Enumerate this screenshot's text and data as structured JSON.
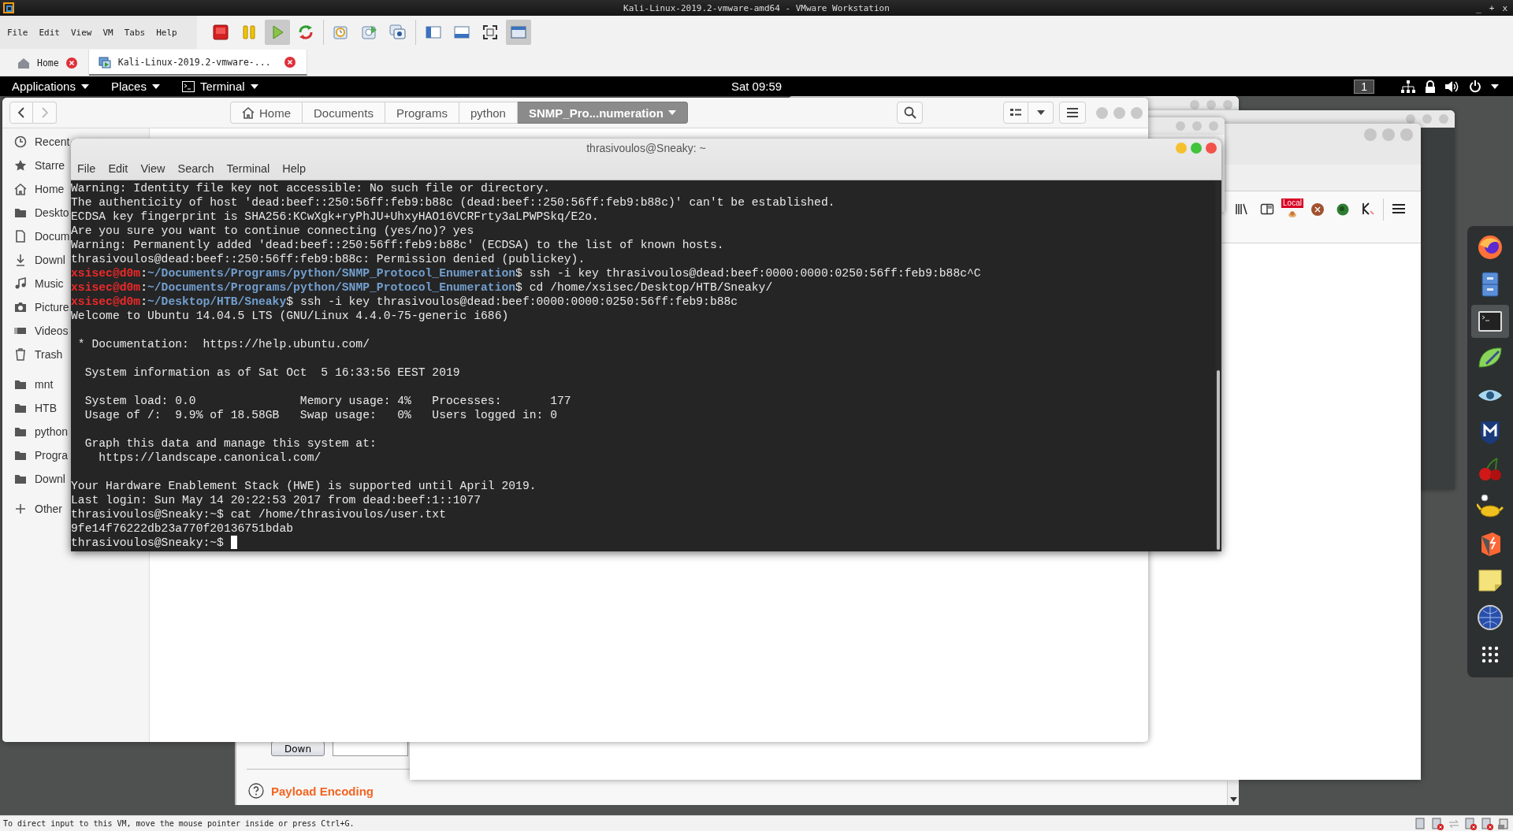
{
  "vmware": {
    "title": "Kali-Linux-2019.2-vmware-amd64 - VMware Workstation",
    "window_controls": [
      "_",
      "+",
      "x"
    ],
    "menu": [
      "File",
      "Edit",
      "View",
      "VM",
      "Tabs",
      "Help"
    ],
    "toolbar_groups": [
      {
        "buttons": [
          {
            "kind": "stop",
            "pressed": false
          },
          {
            "kind": "pause",
            "pressed": false
          },
          {
            "kind": "play",
            "pressed": true
          },
          {
            "kind": "revert",
            "pressed": false
          }
        ]
      },
      {
        "buttons": [
          {
            "kind": "snapshot",
            "pressed": false
          },
          {
            "kind": "snapshot-revert",
            "pressed": false
          },
          {
            "kind": "snapshot-manager",
            "pressed": false
          }
        ]
      },
      {
        "buttons": [
          {
            "kind": "library",
            "pressed": false
          },
          {
            "kind": "console",
            "pressed": false
          },
          {
            "kind": "fullscreen",
            "pressed": false
          },
          {
            "kind": "unity",
            "pressed": true
          }
        ]
      }
    ],
    "tabs": [
      {
        "label": "Home",
        "kind": "home",
        "selected": false
      },
      {
        "label": "Kali-Linux-2019.2-vmware-...",
        "kind": "vm",
        "selected": true
      }
    ],
    "status_text": "To direct input to this VM, move the mouse pointer inside or press Ctrl+G."
  },
  "panel": {
    "menus": [
      {
        "label": "Applications",
        "kind": "menu"
      },
      {
        "label": "Places",
        "kind": "menu"
      },
      {
        "label": "Terminal",
        "kind": "app"
      }
    ],
    "clock": "Sat 09:59",
    "workspace": "1"
  },
  "files": {
    "path": [
      {
        "label": "Home",
        "kind": "home",
        "selected": false
      },
      {
        "label": "Documents",
        "kind": "folder",
        "selected": false
      },
      {
        "label": "Programs",
        "kind": "folder",
        "selected": false
      },
      {
        "label": "python",
        "kind": "folder",
        "selected": false
      },
      {
        "label": "SNMP_Pro...numeration",
        "kind": "folder",
        "selected": true
      }
    ],
    "sidebar_sections": [
      {
        "items": [
          {
            "label": "Recent",
            "kind": "recent"
          },
          {
            "label": "Starre",
            "kind": "starred"
          },
          {
            "label": "Home",
            "kind": "home"
          },
          {
            "label": "Deskto",
            "kind": "folder"
          },
          {
            "label": "Docum",
            "kind": "document"
          },
          {
            "label": "Downl",
            "kind": "download"
          },
          {
            "label": "Music",
            "kind": "music"
          },
          {
            "label": "Picture",
            "kind": "camera"
          },
          {
            "label": "Videos",
            "kind": "video"
          },
          {
            "label": "Trash",
            "kind": "trash"
          }
        ]
      },
      {
        "items": [
          {
            "label": "mnt",
            "kind": "folder"
          },
          {
            "label": "HTB",
            "kind": "folder"
          },
          {
            "label": "python",
            "kind": "folder"
          },
          {
            "label": "Progra",
            "kind": "folder"
          },
          {
            "label": "Downl",
            "kind": "folder"
          }
        ]
      },
      {
        "items": [
          {
            "label": "Other",
            "kind": "other"
          }
        ]
      }
    ]
  },
  "browser": {
    "badge": "Local"
  },
  "burp": {
    "button": "Down",
    "section": "Payload Encoding"
  },
  "terminal": {
    "title": "thrasivoulos@Sneaky: ~",
    "menu": [
      "File",
      "Edit",
      "View",
      "Search",
      "Terminal",
      "Help"
    ],
    "lines": [
      {
        "kind": "output",
        "text": "Warning: Identity file key not accessible: No such file or directory."
      },
      {
        "kind": "output",
        "text": "The authenticity of host 'dead:beef::250:56ff:feb9:b88c (dead:beef::250:56ff:feb9:b88c)' can't be established."
      },
      {
        "kind": "output",
        "text": "ECDSA key fingerprint is SHA256:KCwXgk+ryPhJU+UhxyHAO16VCRFrty3aLPWPSkq/E2o."
      },
      {
        "kind": "output",
        "text": "Are you sure you want to continue connecting (yes/no)? yes"
      },
      {
        "kind": "output",
        "text": "Warning: Permanently added 'dead:beef::250:56ff:feb9:b88c' (ECDSA) to the list of known hosts."
      },
      {
        "kind": "output",
        "text": "thrasivoulos@dead:beef::250:56ff:feb9:b88c: Permission denied (publickey)."
      },
      {
        "kind": "prompt",
        "user": "xsisec@d0m",
        "sep": ":",
        "path": "~/Documents/Programs/python/SNMP_Protocol_Enumeration",
        "end": "$",
        "command": "ssh -i key thrasivoulos@dead:beef:0000:0000:0250:56ff:feb9:b88c^C"
      },
      {
        "kind": "prompt",
        "user": "xsisec@d0m",
        "sep": ":",
        "path": "~/Documents/Programs/python/SNMP_Protocol_Enumeration",
        "end": "$",
        "command": "cd /home/xsisec/Desktop/HTB/Sneaky/"
      },
      {
        "kind": "prompt",
        "user": "xsisec@d0m",
        "sep": ":",
        "path": "~/Desktop/HTB/Sneaky",
        "end": "$",
        "command": "ssh -i key thrasivoulos@dead:beef:0000:0000:0250:56ff:feb9:b88c"
      },
      {
        "kind": "output",
        "text": "Welcome to Ubuntu 14.04.5 LTS (GNU/Linux 4.4.0-75-generic i686)"
      },
      {
        "kind": "blank"
      },
      {
        "kind": "output",
        "text": " * Documentation:  https://help.ubuntu.com/"
      },
      {
        "kind": "blank"
      },
      {
        "kind": "output",
        "text": "  System information as of Sat Oct  5 16:33:56 EEST 2019"
      },
      {
        "kind": "blank"
      },
      {
        "kind": "output",
        "text": "  System load: 0.0               Memory usage: 4%   Processes:       177"
      },
      {
        "kind": "output",
        "text": "  Usage of /:  9.9% of 18.58GB   Swap usage:   0%   Users logged in: 0"
      },
      {
        "kind": "blank"
      },
      {
        "kind": "output",
        "text": "  Graph this data and manage this system at:"
      },
      {
        "kind": "output",
        "text": "    https://landscape.canonical.com/"
      },
      {
        "kind": "blank"
      },
      {
        "kind": "output",
        "text": "Your Hardware Enablement Stack (HWE) is supported until April 2019."
      },
      {
        "kind": "output",
        "text": "Last login: Sun May 14 20:22:53 2017 from dead:beef:1::1077"
      },
      {
        "kind": "output",
        "text": "thrasivoulos@Sneaky:~$ cat /home/thrasivoulos/user.txt"
      },
      {
        "kind": "output",
        "text": "9fe14f76222db23a770f20136751bdab"
      },
      {
        "kind": "input",
        "text": "thrasivoulos@Sneaky:~$"
      }
    ]
  },
  "dock": [
    {
      "kind": "firefox",
      "selected": false
    },
    {
      "kind": "files",
      "selected": false
    },
    {
      "kind": "terminal",
      "selected": true
    },
    {
      "kind": "leafpad",
      "selected": false
    },
    {
      "kind": "eye",
      "selected": false
    },
    {
      "kind": "shield",
      "selected": false
    },
    {
      "kind": "cherry",
      "selected": false
    },
    {
      "kind": "genie",
      "selected": false
    },
    {
      "kind": "burp",
      "selected": false
    },
    {
      "kind": "note",
      "selected": false
    },
    {
      "kind": "globe",
      "selected": false
    },
    {
      "kind": "grid",
      "selected": false
    }
  ]
}
